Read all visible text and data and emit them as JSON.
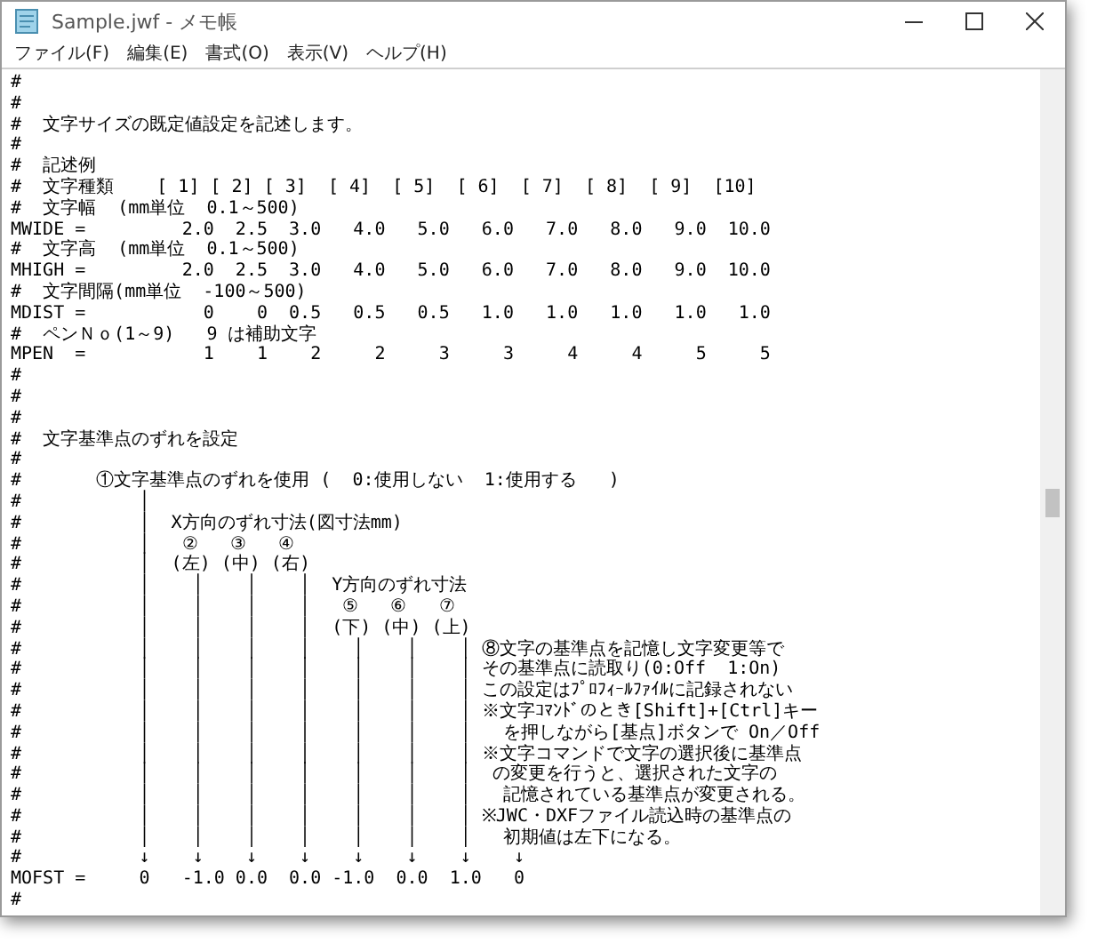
{
  "window": {
    "title": "Sample.jwf - メモ帳"
  },
  "menu": [
    "ファイル(F)",
    "編集(E)",
    "書式(O)",
    "表示(V)",
    "ヘルプ(H)"
  ],
  "editor": {
    "lines": [
      "#",
      "#",
      "#  文字サイズの既定値設定を記述します。",
      "#",
      "#  記述例",
      "#  文字種類    [ 1] [ 2] [ 3]  [ 4]  [ 5]  [ 6]  [ 7]  [ 8]  [ 9]  [10]",
      "#  文字幅  (mm単位  0.1～500)",
      "MWIDE =         2.0  2.5  3.0   4.0   5.0   6.0   7.0   8.0   9.0  10.0",
      "#  文字高  (mm単位  0.1～500)",
      "MHIGH =         2.0  2.5  3.0   4.0   5.0   6.0   7.0   8.0   9.0  10.0",
      "#  文字間隔(mm単位  -100～500)",
      "MDIST =           0    0  0.5   0.5   0.5   1.0   1.0   1.0   1.0   1.0",
      "#  ペンＮｏ(1～9)   9 は補助文字",
      "MPEN  =           1    1    2     2     3     3     4     4     5     5",
      "#",
      "#",
      "#",
      "#  文字基準点のずれを設定",
      "#",
      "#       ①文字基準点のずれを使用 (  0:使用しない  1:使用する   )",
      "#           │",
      "#           │  X方向のずれ寸法(図寸法mm)",
      "#           │   ②   ③   ④",
      "#           │  (左) (中) (右)",
      "#           │    │    │    │  Y方向のずれ寸法",
      "#           │    │    │    │   ⑤   ⑥   ⑦",
      "#           │    │    │    │  (下) (中) (上)",
      "#           │    │    │    │    │    │    │ ⑧文字の基準点を記憶し文字変更等で",
      "#           │    │    │    │    │    │    │ その基準点に読取り(0:Off  1:On)",
      "#           │    │    │    │    │    │    │ この設定はﾌﾟﾛﾌｨｰﾙﾌｧｲﾙに記録されない",
      "#           │    │    │    │    │    │    │ ※文字ｺﾏﾝﾄﾞのとき[Shift]+[Ctrl]キー",
      "#           │    │    │    │    │    │    │   を押しながら[基点]ボタンで On／Off",
      "#           │    │    │    │    │    │    │ ※文字コマンドで文字の選択後に基準点",
      "#           │    │    │    │    │    │    │  の変更を行うと、選択された文字の",
      "#           │    │    │    │    │    │    │   記憶されている基準点が変更される。",
      "#           │    │    │    │    │    │    │ ※JWC・DXFファイル読込時の基準点の",
      "#           │    │    │    │    │    │    │   初期値は左下になる。",
      "#           ↓    ↓    ↓    ↓    ↓    ↓    ↓    ↓",
      "MOFST =     0   -1.0 0.0  0.0 -1.0  0.0  1.0   0",
      "#"
    ]
  }
}
